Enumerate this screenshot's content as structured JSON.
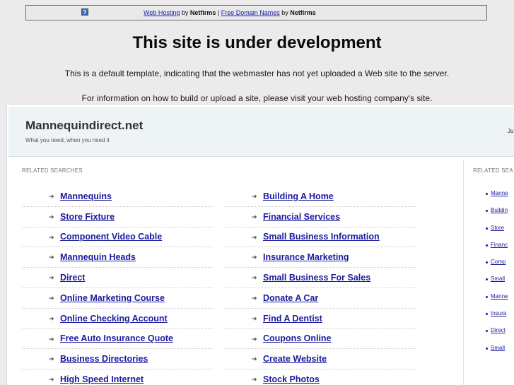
{
  "topbar": {
    "icon": "question-mark-icon",
    "link1": "Web Hosting",
    "by1": " by ",
    "brand1": "Netfirms",
    "sep": " | ",
    "link2": "Free Domain Names",
    "by2": " by ",
    "brand2": "Netfirms"
  },
  "notice": {
    "headline": "This site is under development",
    "line1": "This is a default template, indicating that the webmaster has not yet uploaded a Web site to the server.",
    "line2": "For information on how to build or upload a site, please visit your web hosting company's site."
  },
  "site": {
    "title": "Mannequindirect.net",
    "tagline": "What you need, when you need it",
    "cut_text": "Ju"
  },
  "related": {
    "label": "RELATED SEARCHES",
    "side_label": "RELATED SEA",
    "left": [
      "Mannequins",
      "Store Fixture",
      "Component Video Cable",
      "Mannequin Heads",
      "Direct",
      "Online Marketing Course",
      "Online Checking Account",
      "Free Auto Insurance Quote",
      "Business Directories",
      "High Speed Internet"
    ],
    "right": [
      "Building A Home",
      "Financial Services",
      "Small Business Information",
      "Insurance Marketing",
      "Small Business For Sales",
      "Donate A Car",
      "Find A Dentist",
      "Coupons Online",
      "Create Website",
      "Stock Photos"
    ],
    "side": [
      "Manne",
      "Buildin",
      "Store",
      "Financ",
      "Comp",
      "Small",
      "Manne",
      "Insura",
      "Direct",
      "Small"
    ]
  }
}
